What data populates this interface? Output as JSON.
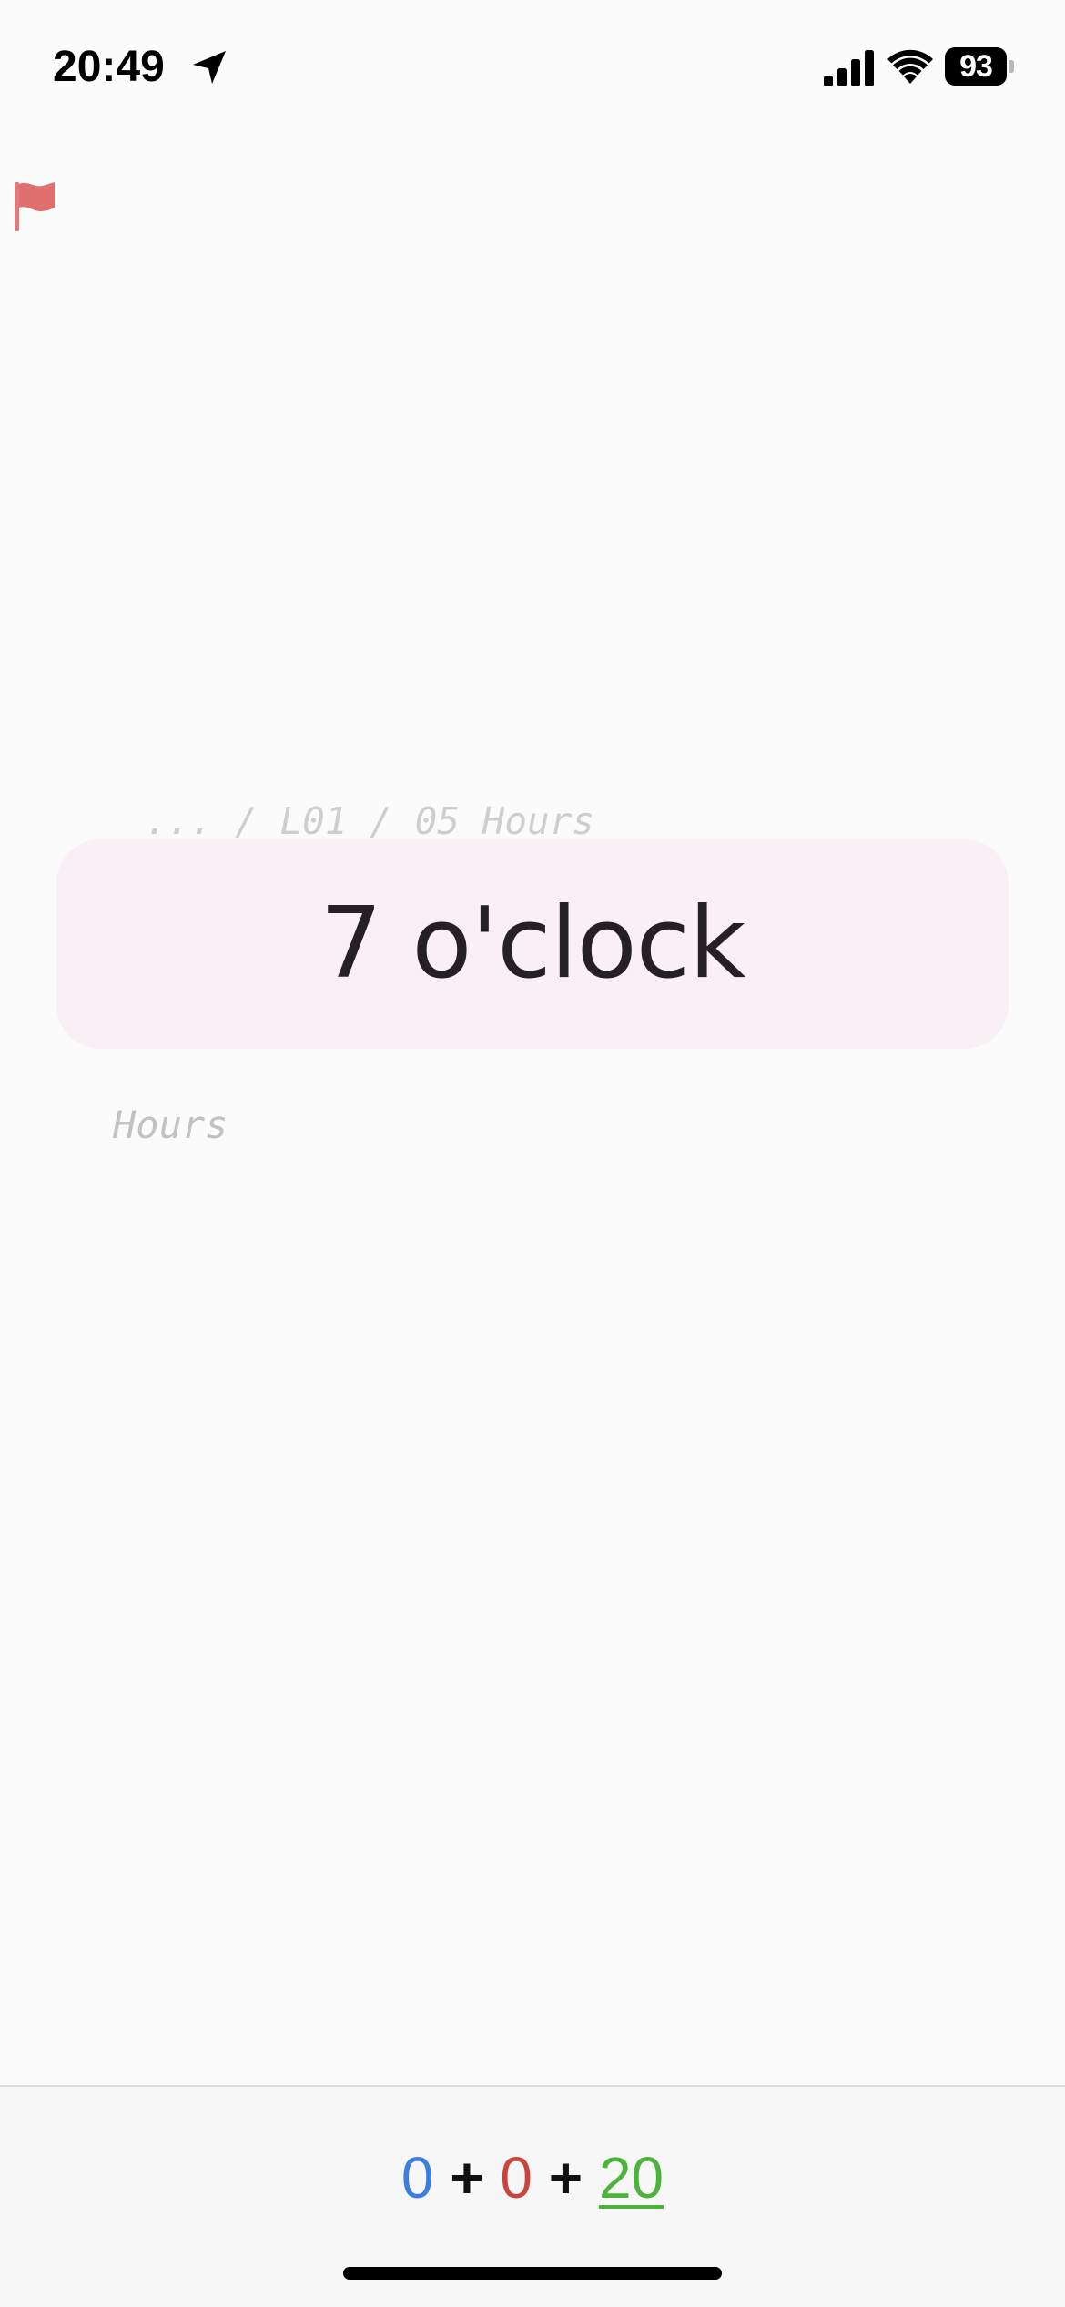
{
  "status_bar": {
    "time": "20:49",
    "battery": "93",
    "icons": [
      "location-arrow-icon",
      "cellular-signal-icon",
      "wifi-icon",
      "battery-icon"
    ]
  },
  "flag": {
    "icon": "flag-icon",
    "color": "#e07070"
  },
  "breadcrumb": {
    "ellipsis": "...",
    "separator": " / ",
    "items": [
      "L01",
      "05 Hours"
    ]
  },
  "card": {
    "text": "7 o'clock",
    "background": "#f8f0f4"
  },
  "subtitle": "Hours",
  "score": {
    "blue_value": "0",
    "red_value": "0",
    "green_value": "20",
    "plus": "+",
    "colors": {
      "blue": "#3b7de0",
      "red": "#c9453c",
      "green": "#4db33d"
    }
  }
}
